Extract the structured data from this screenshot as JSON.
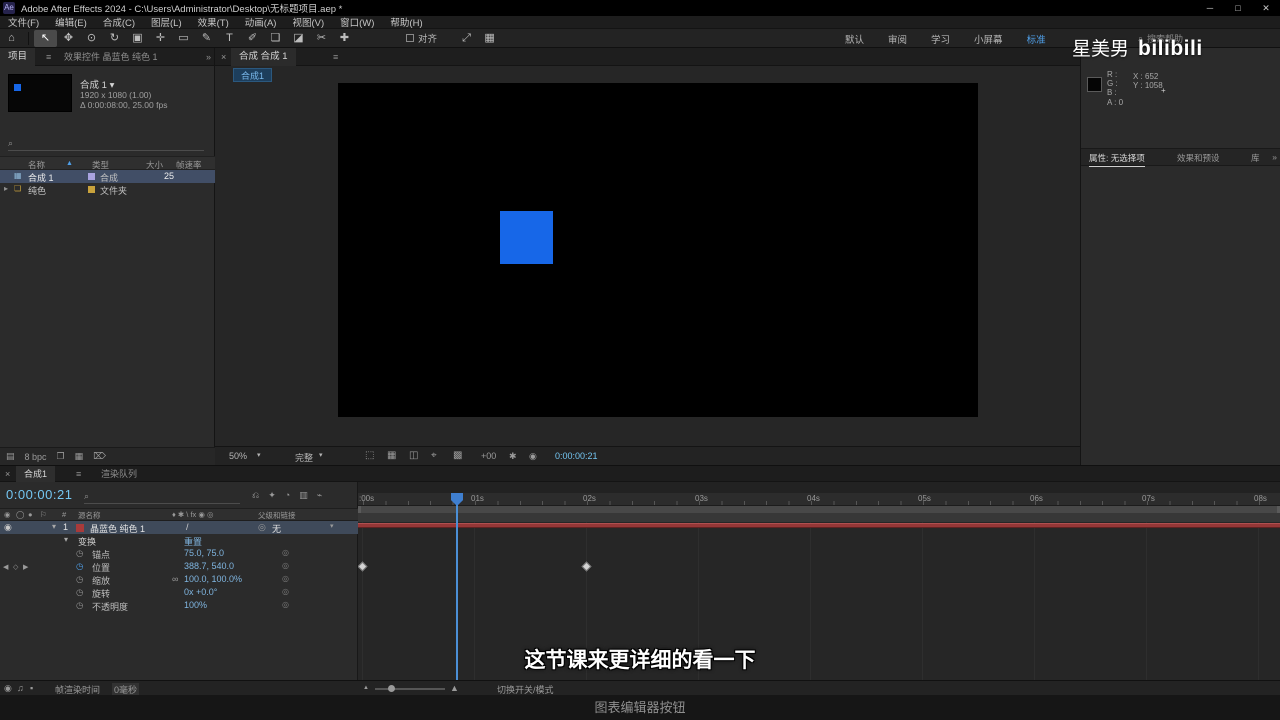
{
  "colors": {
    "accent_blue": "#3d8fd6",
    "solid_blue": "#1767e8",
    "layer_bar_red": "#953737",
    "timecode_cyan": "#74c6f2"
  },
  "title_bar": {
    "app_icon": "Ae",
    "title": "Adobe After Effects 2024 - C:\\Users\\Administrator\\Desktop\\无标题项目.aep *",
    "minimize": "─",
    "maximize": "□",
    "close": "✕"
  },
  "menu_bar": {
    "items": [
      "文件(F)",
      "编辑(E)",
      "合成(C)",
      "图层(L)",
      "效果(T)",
      "动画(A)",
      "视图(V)",
      "窗口(W)",
      "帮助(H)"
    ]
  },
  "toolbar": {
    "tools": [
      {
        "name": "home",
        "glyph": "⌂"
      },
      {
        "name": "selection",
        "glyph": "↖"
      },
      {
        "name": "hand",
        "glyph": "✥"
      },
      {
        "name": "zoom",
        "glyph": "⊙"
      },
      {
        "name": "rotation",
        "glyph": "↻"
      },
      {
        "name": "camera",
        "glyph": "▣"
      },
      {
        "name": "pan-behind",
        "glyph": "✛"
      },
      {
        "name": "shape",
        "glyph": "▭"
      },
      {
        "name": "pen",
        "glyph": "✎"
      },
      {
        "name": "type",
        "glyph": "T"
      },
      {
        "name": "brush",
        "glyph": "✐"
      },
      {
        "name": "clone-stamp",
        "glyph": "❏"
      },
      {
        "name": "eraser",
        "glyph": "◪"
      },
      {
        "name": "roto-brush",
        "glyph": "✂"
      },
      {
        "name": "puppet",
        "glyph": "✚"
      }
    ],
    "snap_label": "对齐",
    "extra_icons": [
      {
        "name": "workspace-grid",
        "glyph": "⤢"
      },
      {
        "name": "panel-grid",
        "glyph": "▦"
      }
    ],
    "workspaces": [
      "默认",
      "审阅",
      "学习",
      "小屏幕",
      "标准"
    ],
    "active_workspace": "标准",
    "search_glyph": "⌕",
    "search_help": "搜索帮助"
  },
  "project_panel": {
    "tab_active": "项目",
    "tab_menu": "≡",
    "tab_inactive": "效果控件 晶蓝色 纯色 1",
    "overflow": "»",
    "comp_name": "合成 1",
    "comp_caret": "▾",
    "comp_dims": "1920 x 1080 (1.00)",
    "comp_time": "Δ 0:00:08:00, 25.00 fps",
    "search_glyph": "⌕",
    "columns": [
      "名称",
      "类型",
      "大小",
      "帧速率"
    ],
    "sort_arrow": "▲",
    "rows": [
      {
        "twirl": "",
        "icon": "▦",
        "name": "合成 1",
        "type": "合成",
        "rate": "25"
      },
      {
        "twirl": "▸",
        "icon": "❏",
        "name": "纯色",
        "type": "文件夹",
        "rate": ""
      }
    ],
    "depth_label": "8 bpc",
    "bottom_icons": [
      {
        "name": "interpret-footage",
        "glyph": "▤"
      },
      {
        "name": "new-folder",
        "glyph": "❐"
      },
      {
        "name": "new-composition",
        "glyph": "▦"
      },
      {
        "name": "delete",
        "glyph": "⌦"
      }
    ]
  },
  "comp_panel": {
    "close": "×",
    "tab": "合成 合成 1",
    "menu": "≡",
    "viewer_tab": "合成1",
    "zoom": "50%",
    "caret": "▾",
    "resolution": "完整",
    "view_icons": [
      {
        "name": "region-of-interest",
        "glyph": "⬚"
      },
      {
        "name": "grid-guides",
        "glyph": "▦"
      },
      {
        "name": "mask-visibility",
        "glyph": "◫"
      },
      {
        "name": "current-view",
        "glyph": "⌖"
      },
      {
        "name": "transparency-grid",
        "glyph": "▩"
      }
    ],
    "exposure": "+00",
    "gear_glyph": "✱",
    "snapshot_glyph": "◉",
    "timecode": "0:00:00:21"
  },
  "watermark": {
    "name": "星美男",
    "brand": "bilibili"
  },
  "info_panel": {
    "r": "R :",
    "g": "G :",
    "b": "B :",
    "a": "A : 0",
    "x": "X : 652",
    "y": "Y : 1058",
    "crosshair": "+"
  },
  "right_tabs": {
    "properties": "属性: 无选择项",
    "effects": "效果和预设",
    "library": "库",
    "overflow": "»"
  },
  "timeline": {
    "close": "×",
    "tab_active": "合成1",
    "tab_menu": "≡",
    "tab_inactive": "渲染队列",
    "timecode": "0:00:00:21",
    "search_glyph": "⌕",
    "tool_icons": [
      {
        "name": "mini-flowchart",
        "glyph": "⎌"
      },
      {
        "name": "draft-3d",
        "glyph": "✦"
      },
      {
        "name": "shy",
        "glyph": "◔"
      },
      {
        "name": "frame-blend",
        "glyph": "▥"
      },
      {
        "name": "motion-blur",
        "glyph": "⌁"
      }
    ],
    "header": {
      "av": [
        "◉",
        "◯",
        "●",
        "⚐"
      ],
      "index": "#",
      "source": "源名称",
      "switches": "♦ ✱ \\ fx ◉ ◎",
      "parent": "父级和链接"
    },
    "layer": {
      "eye": "◉",
      "twirl": "▾",
      "index": "1",
      "name": "晶蓝色 纯色 1",
      "quality": "/",
      "parent_icon": "◎",
      "parent_value": "无",
      "caret": "▾"
    },
    "group": {
      "twirl": "▾",
      "name": "变换",
      "reset": "重置"
    },
    "stopwatch": "◷",
    "circle": "◎",
    "nav": {
      "prev": "◀",
      "dot": "◇",
      "next": "▶"
    },
    "props": [
      {
        "name": "锚点",
        "value": "75.0, 75.0"
      },
      {
        "name": "位置",
        "value": "388.7, 540.0"
      },
      {
        "name": "缩放",
        "link": "∞",
        "value": "100.0, 100.0%"
      },
      {
        "name": "旋转",
        "value": "0x +0.0°"
      },
      {
        "name": "不透明度",
        "value": "100%"
      }
    ],
    "ruler": [
      ":00s",
      "01s",
      "02s",
      "03s",
      "04s",
      "05s",
      "06s",
      "07s",
      "08s"
    ]
  },
  "status_bar": {
    "icons": [
      {
        "name": "live-update",
        "glyph": "◉"
      },
      {
        "name": "audio-mute",
        "glyph": "♫"
      },
      {
        "name": "capture",
        "glyph": "▪"
      }
    ],
    "render_label": "帧渲染时间",
    "render_value": "0毫秒",
    "zoom_out": "▲",
    "zoom_in": "▲",
    "toggle_label": "切换开关/模式"
  },
  "caption": {
    "text": "图表编辑器按钮"
  },
  "subtitle": {
    "text": "这节课来更详细的看一下"
  }
}
